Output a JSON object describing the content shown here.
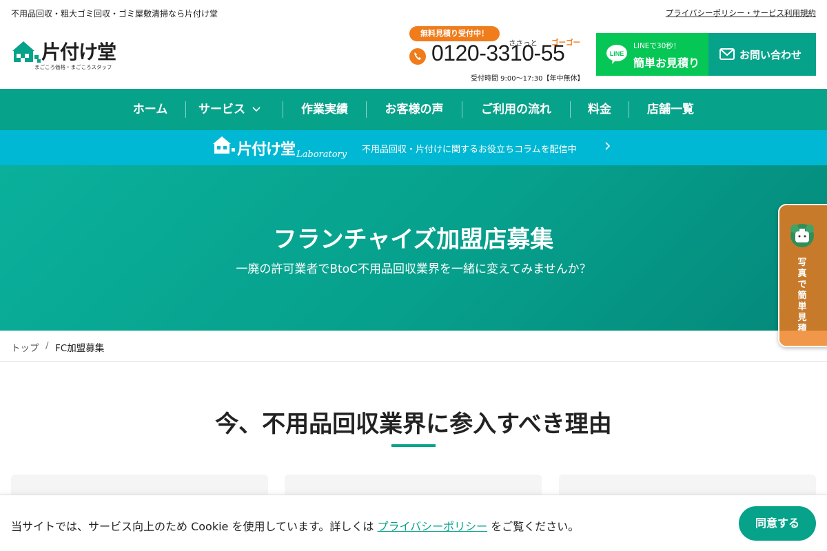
{
  "top_bar": {
    "tagline": "不用品回収・粗大ゴミ回収・ゴミ屋敷清掃なら片付け堂",
    "policy_link": "プライバシーポリシー・サービス利用規約"
  },
  "header": {
    "logo": {
      "name": "片付け堂",
      "tagline": "まごころ価格・まごころスタッフ"
    },
    "free_estimate_badge": "無料見積り受付中！",
    "phone": {
      "ruby_left": "ささっと",
      "ruby_right": "ゴーゴー",
      "number": "0120-3310-55",
      "hours": "受付時間 9:00〜17:30【年中無休】"
    },
    "line_button": {
      "small": "LINEで30秒！",
      "label": "簡単お見積り",
      "icon_text": "LINE"
    },
    "contact_button": {
      "label": "お問い合わせ"
    }
  },
  "nav": {
    "items": [
      {
        "label": "ホーム"
      },
      {
        "label": "サービス"
      },
      {
        "label": "作業実績"
      },
      {
        "label": "お客様の声"
      },
      {
        "label": "ご利用の流れ"
      },
      {
        "label": "料金"
      },
      {
        "label": "店舗一覧"
      }
    ]
  },
  "lab_bar": {
    "logo_main": "片付け堂",
    "logo_sub": "Laboratory",
    "text": "不用品回収・片付けに関するお役立ちコラムを配信中"
  },
  "hero": {
    "title": "フランチャイズ加盟店募集",
    "subtitle": "一廃の許可業者でBtoC不用品回収業界を一緒に変えてみませんか？"
  },
  "floating_tab": {
    "label": "写真で簡単見積"
  },
  "breadcrumb": {
    "home": "トップ",
    "separator": "/",
    "current": "FC加盟募集"
  },
  "section": {
    "title": "今、不用品回収業界に参入すべき理由"
  },
  "cookie": {
    "text_before": "当サイトでは、サービス向上のため Cookie を使用しています。詳しくは",
    "link": "プライバシーポリシー",
    "text_after": "をご覧ください。",
    "agree_button": "同意する"
  },
  "colors": {
    "brand_green": "#07a28a",
    "line_green": "#06c755",
    "accent_orange": "#f07c1b",
    "lab_cyan": "#00b8d4"
  }
}
